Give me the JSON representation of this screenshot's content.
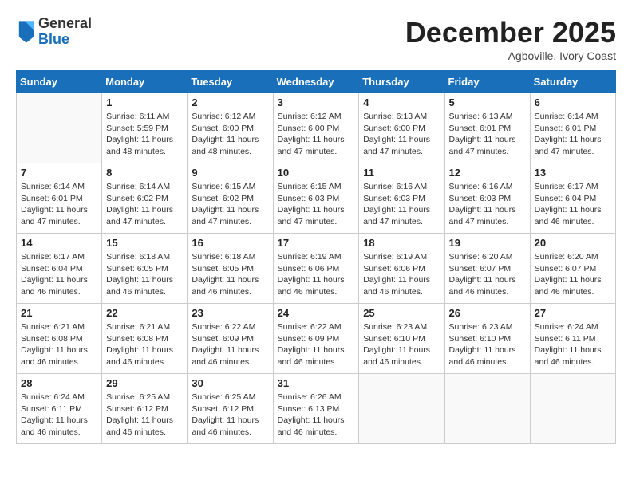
{
  "header": {
    "logo_general": "General",
    "logo_blue": "Blue",
    "month_title": "December 2025",
    "subtitle": "Agboville, Ivory Coast"
  },
  "calendar": {
    "days_of_week": [
      "Sunday",
      "Monday",
      "Tuesday",
      "Wednesday",
      "Thursday",
      "Friday",
      "Saturday"
    ],
    "weeks": [
      [
        {
          "day": "",
          "info": ""
        },
        {
          "day": "1",
          "info": "Sunrise: 6:11 AM\nSunset: 5:59 PM\nDaylight: 11 hours\nand 48 minutes."
        },
        {
          "day": "2",
          "info": "Sunrise: 6:12 AM\nSunset: 6:00 PM\nDaylight: 11 hours\nand 48 minutes."
        },
        {
          "day": "3",
          "info": "Sunrise: 6:12 AM\nSunset: 6:00 PM\nDaylight: 11 hours\nand 47 minutes."
        },
        {
          "day": "4",
          "info": "Sunrise: 6:13 AM\nSunset: 6:00 PM\nDaylight: 11 hours\nand 47 minutes."
        },
        {
          "day": "5",
          "info": "Sunrise: 6:13 AM\nSunset: 6:01 PM\nDaylight: 11 hours\nand 47 minutes."
        },
        {
          "day": "6",
          "info": "Sunrise: 6:14 AM\nSunset: 6:01 PM\nDaylight: 11 hours\nand 47 minutes."
        }
      ],
      [
        {
          "day": "7",
          "info": "Sunrise: 6:14 AM\nSunset: 6:01 PM\nDaylight: 11 hours\nand 47 minutes."
        },
        {
          "day": "8",
          "info": "Sunrise: 6:14 AM\nSunset: 6:02 PM\nDaylight: 11 hours\nand 47 minutes."
        },
        {
          "day": "9",
          "info": "Sunrise: 6:15 AM\nSunset: 6:02 PM\nDaylight: 11 hours\nand 47 minutes."
        },
        {
          "day": "10",
          "info": "Sunrise: 6:15 AM\nSunset: 6:03 PM\nDaylight: 11 hours\nand 47 minutes."
        },
        {
          "day": "11",
          "info": "Sunrise: 6:16 AM\nSunset: 6:03 PM\nDaylight: 11 hours\nand 47 minutes."
        },
        {
          "day": "12",
          "info": "Sunrise: 6:16 AM\nSunset: 6:03 PM\nDaylight: 11 hours\nand 47 minutes."
        },
        {
          "day": "13",
          "info": "Sunrise: 6:17 AM\nSunset: 6:04 PM\nDaylight: 11 hours\nand 46 minutes."
        }
      ],
      [
        {
          "day": "14",
          "info": "Sunrise: 6:17 AM\nSunset: 6:04 PM\nDaylight: 11 hours\nand 46 minutes."
        },
        {
          "day": "15",
          "info": "Sunrise: 6:18 AM\nSunset: 6:05 PM\nDaylight: 11 hours\nand 46 minutes."
        },
        {
          "day": "16",
          "info": "Sunrise: 6:18 AM\nSunset: 6:05 PM\nDaylight: 11 hours\nand 46 minutes."
        },
        {
          "day": "17",
          "info": "Sunrise: 6:19 AM\nSunset: 6:06 PM\nDaylight: 11 hours\nand 46 minutes."
        },
        {
          "day": "18",
          "info": "Sunrise: 6:19 AM\nSunset: 6:06 PM\nDaylight: 11 hours\nand 46 minutes."
        },
        {
          "day": "19",
          "info": "Sunrise: 6:20 AM\nSunset: 6:07 PM\nDaylight: 11 hours\nand 46 minutes."
        },
        {
          "day": "20",
          "info": "Sunrise: 6:20 AM\nSunset: 6:07 PM\nDaylight: 11 hours\nand 46 minutes."
        }
      ],
      [
        {
          "day": "21",
          "info": "Sunrise: 6:21 AM\nSunset: 6:08 PM\nDaylight: 11 hours\nand 46 minutes."
        },
        {
          "day": "22",
          "info": "Sunrise: 6:21 AM\nSunset: 6:08 PM\nDaylight: 11 hours\nand 46 minutes."
        },
        {
          "day": "23",
          "info": "Sunrise: 6:22 AM\nSunset: 6:09 PM\nDaylight: 11 hours\nand 46 minutes."
        },
        {
          "day": "24",
          "info": "Sunrise: 6:22 AM\nSunset: 6:09 PM\nDaylight: 11 hours\nand 46 minutes."
        },
        {
          "day": "25",
          "info": "Sunrise: 6:23 AM\nSunset: 6:10 PM\nDaylight: 11 hours\nand 46 minutes."
        },
        {
          "day": "26",
          "info": "Sunrise: 6:23 AM\nSunset: 6:10 PM\nDaylight: 11 hours\nand 46 minutes."
        },
        {
          "day": "27",
          "info": "Sunrise: 6:24 AM\nSunset: 6:11 PM\nDaylight: 11 hours\nand 46 minutes."
        }
      ],
      [
        {
          "day": "28",
          "info": "Sunrise: 6:24 AM\nSunset: 6:11 PM\nDaylight: 11 hours\nand 46 minutes."
        },
        {
          "day": "29",
          "info": "Sunrise: 6:25 AM\nSunset: 6:12 PM\nDaylight: 11 hours\nand 46 minutes."
        },
        {
          "day": "30",
          "info": "Sunrise: 6:25 AM\nSunset: 6:12 PM\nDaylight: 11 hours\nand 46 minutes."
        },
        {
          "day": "31",
          "info": "Sunrise: 6:26 AM\nSunset: 6:13 PM\nDaylight: 11 hours\nand 46 minutes."
        },
        {
          "day": "",
          "info": ""
        },
        {
          "day": "",
          "info": ""
        },
        {
          "day": "",
          "info": ""
        }
      ]
    ]
  }
}
